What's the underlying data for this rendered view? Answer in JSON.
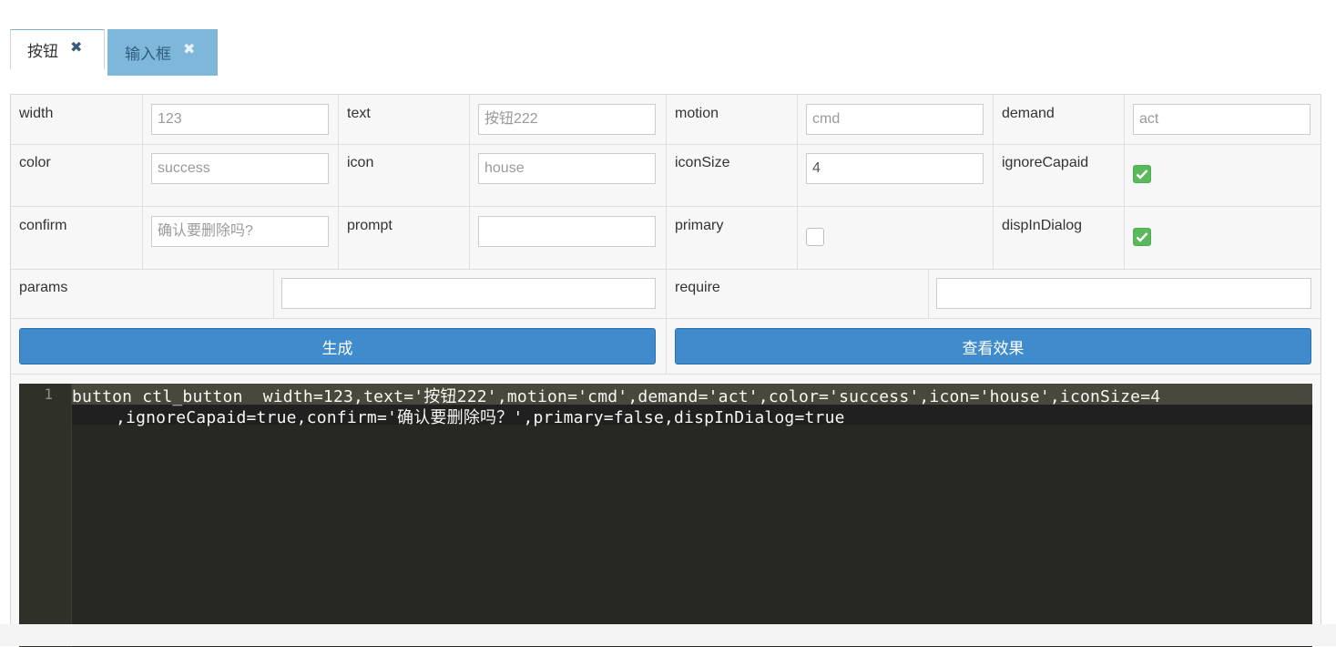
{
  "tabs": [
    {
      "label": "按钮",
      "close": "✖",
      "active": true
    },
    {
      "label": "输入框",
      "close": "✖",
      "active": false
    }
  ],
  "form": {
    "width": {
      "label": "width",
      "placeholder": "123"
    },
    "text": {
      "label": "text",
      "placeholder": "按钮222"
    },
    "motion": {
      "label": "motion",
      "placeholder": "cmd"
    },
    "demand": {
      "label": "demand",
      "placeholder": "act"
    },
    "color": {
      "label": "color",
      "placeholder": "success"
    },
    "icon": {
      "label": "icon",
      "placeholder": "house"
    },
    "iconSize": {
      "label": "iconSize",
      "value": "4"
    },
    "ignoreCapaid": {
      "label": "ignoreCapaid",
      "checked": true
    },
    "confirm": {
      "label": "confirm",
      "placeholder": "确认要删除吗?"
    },
    "prompt": {
      "label": "prompt",
      "value": ""
    },
    "primary": {
      "label": "primary",
      "checked": false
    },
    "dispInDialog": {
      "label": "dispInDialog",
      "checked": true
    },
    "params": {
      "label": "params",
      "value": ""
    },
    "require": {
      "label": "require",
      "value": ""
    }
  },
  "buttons": {
    "generate": "生成",
    "preview": "查看效果"
  },
  "editor": {
    "line_number": "1",
    "line1": "button ctl_button  width=123,text='按钮222',motion='cmd',demand='act',color='success',icon='house',iconSize=4",
    "line2": ",ignoreCapaid=true,confirm='确认要删除吗？',primary=false,dispInDialog=true"
  },
  "colors": {
    "tab_inactive_bg": "#7fb7db",
    "button_bg": "#3f8bcb",
    "checkbox_on": "#5cb85c",
    "editor_bg": "#272822"
  }
}
